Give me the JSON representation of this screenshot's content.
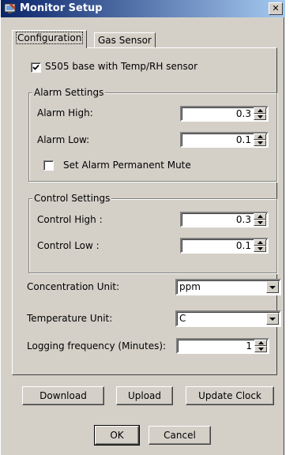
{
  "window": {
    "title": "Monitor Setup",
    "close_label": "✕"
  },
  "tabs": [
    {
      "label": "Configuration",
      "active": true
    },
    {
      "label": "Gas Sensor",
      "active": false
    }
  ],
  "base_sensor": {
    "label": "S505 base with Temp/RH sensor",
    "checked": true
  },
  "alarm": {
    "title": "Alarm Settings",
    "high_label": "Alarm High:",
    "high_value": "0.3",
    "low_label": "Alarm Low:",
    "low_value": "0.1",
    "mute_label": "Set Alarm Permanent Mute",
    "mute_checked": false
  },
  "control": {
    "title": "Control Settings",
    "high_label": "Control High :",
    "high_value": "0.3",
    "low_label": "Control Low :",
    "low_value": "0.1"
  },
  "concentration": {
    "label": "Concentration Unit:",
    "value": "ppm"
  },
  "temperature": {
    "label": "Temperature Unit:",
    "value": "C"
  },
  "logging": {
    "label": "Logging frequency (Minutes):",
    "value": "1"
  },
  "buttons": {
    "download": "Download",
    "upload": "Upload",
    "update_clock": "Update Clock",
    "ok": "OK",
    "cancel": "Cancel"
  }
}
